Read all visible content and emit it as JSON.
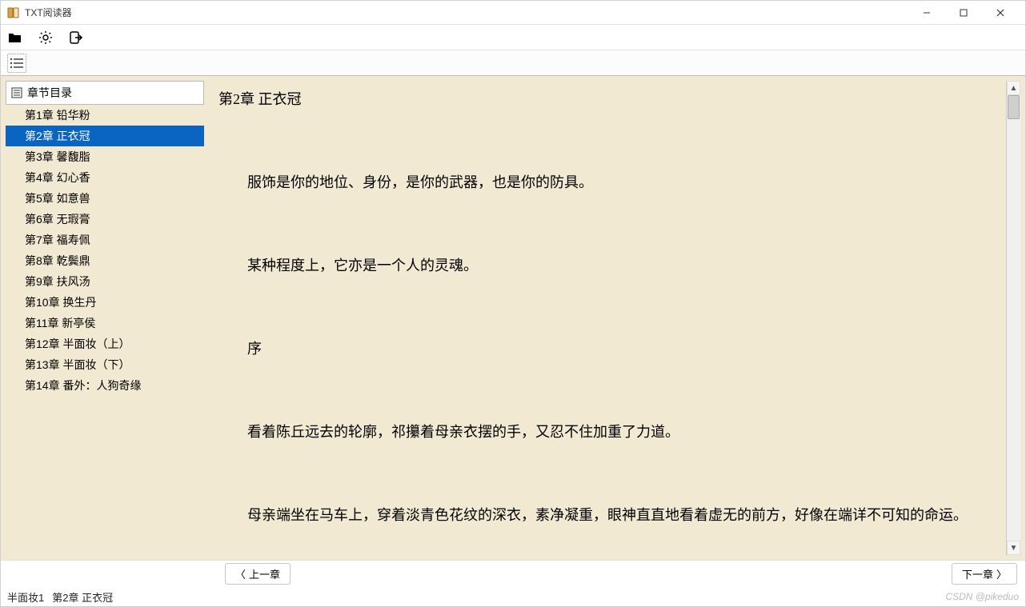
{
  "window": {
    "title": "TXT阅读器"
  },
  "toc": {
    "header": "章节目录",
    "selected_index": 1,
    "items": [
      "第1章 铅华粉",
      "第2章 正衣冠",
      "第3章 馨馥脂",
      "第4章 幻心香",
      "第5章 如意兽",
      "第6章 无瑕膏",
      "第7章 福寿佩",
      "第8章 乾鬓鼎",
      "第9章 扶风汤",
      "第10章 换生丹",
      "第11章 新亭侯",
      "第12章 半面妆（上）",
      "第13章 半面妆（下）",
      "第14章 番外：人狗奇缘"
    ]
  },
  "reader": {
    "chapter_title": "第2章 正衣冠",
    "paragraphs": [
      "服饰是你的地位、身份，是你的武器，也是你的防具。",
      "某种程度上，它亦是一个人的灵魂。",
      "序",
      "看着陈丘远去的轮廓，祁攥着母亲衣摆的手，又忍不住加重了力道。",
      "母亲端坐在马车上，穿着淡青色花纹的深衣，素净凝重，眼神直直地看着虚无的前方，好像在端详不可知的命运。"
    ]
  },
  "nav": {
    "prev": "上一章",
    "next": "下一章"
  },
  "status": {
    "left1": "半面妆1",
    "left2": "第2章 正衣冠",
    "right": "CSDN @pikeduo"
  }
}
